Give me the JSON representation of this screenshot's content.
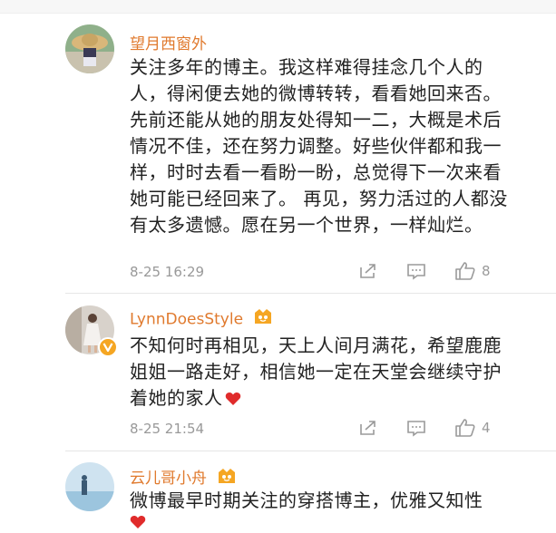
{
  "comments": [
    {
      "username": "望月西窗外",
      "text": "关注多年的博主。我这样难得挂念几个人的人，得闲便去她的微博转转，看看她回来否。先前还能从她的朋友处得知一二，大概是术后情况不佳，还在努力调整。好些伙伴都和我一样，时时去看一看盼一盼，总觉得下一次来看她可能已经回来了。 再见，努力活过的人都没有太多遗憾。愿在另一个世界，一样灿烂。",
      "time": "8-25 16:29",
      "like_count": "8",
      "icons": [
        "share-icon",
        "comment-icon",
        "like-icon"
      ]
    },
    {
      "username": "LynnDoesStyle",
      "text": "不知何时再相见，天上人间月满花，希望鹿鹿姐姐一路走好，相信她一定在天堂会继续守护着她的家人",
      "time": "8-25 21:54",
      "like_count": "4",
      "badges": [
        "vip-badge-icon",
        "verified-badge-icon",
        "heart-emoji-icon"
      ]
    },
    {
      "username": "云儿哥小舟",
      "text": "微博最早时期关注的穿搭博主，优雅又知性",
      "badges": [
        "vip-badge-icon",
        "heart-emoji-icon"
      ]
    }
  ],
  "colors": {
    "username": "#e07a2e",
    "meta": "#999999",
    "heart": "#e02b2b",
    "badge": "#f5a623"
  }
}
